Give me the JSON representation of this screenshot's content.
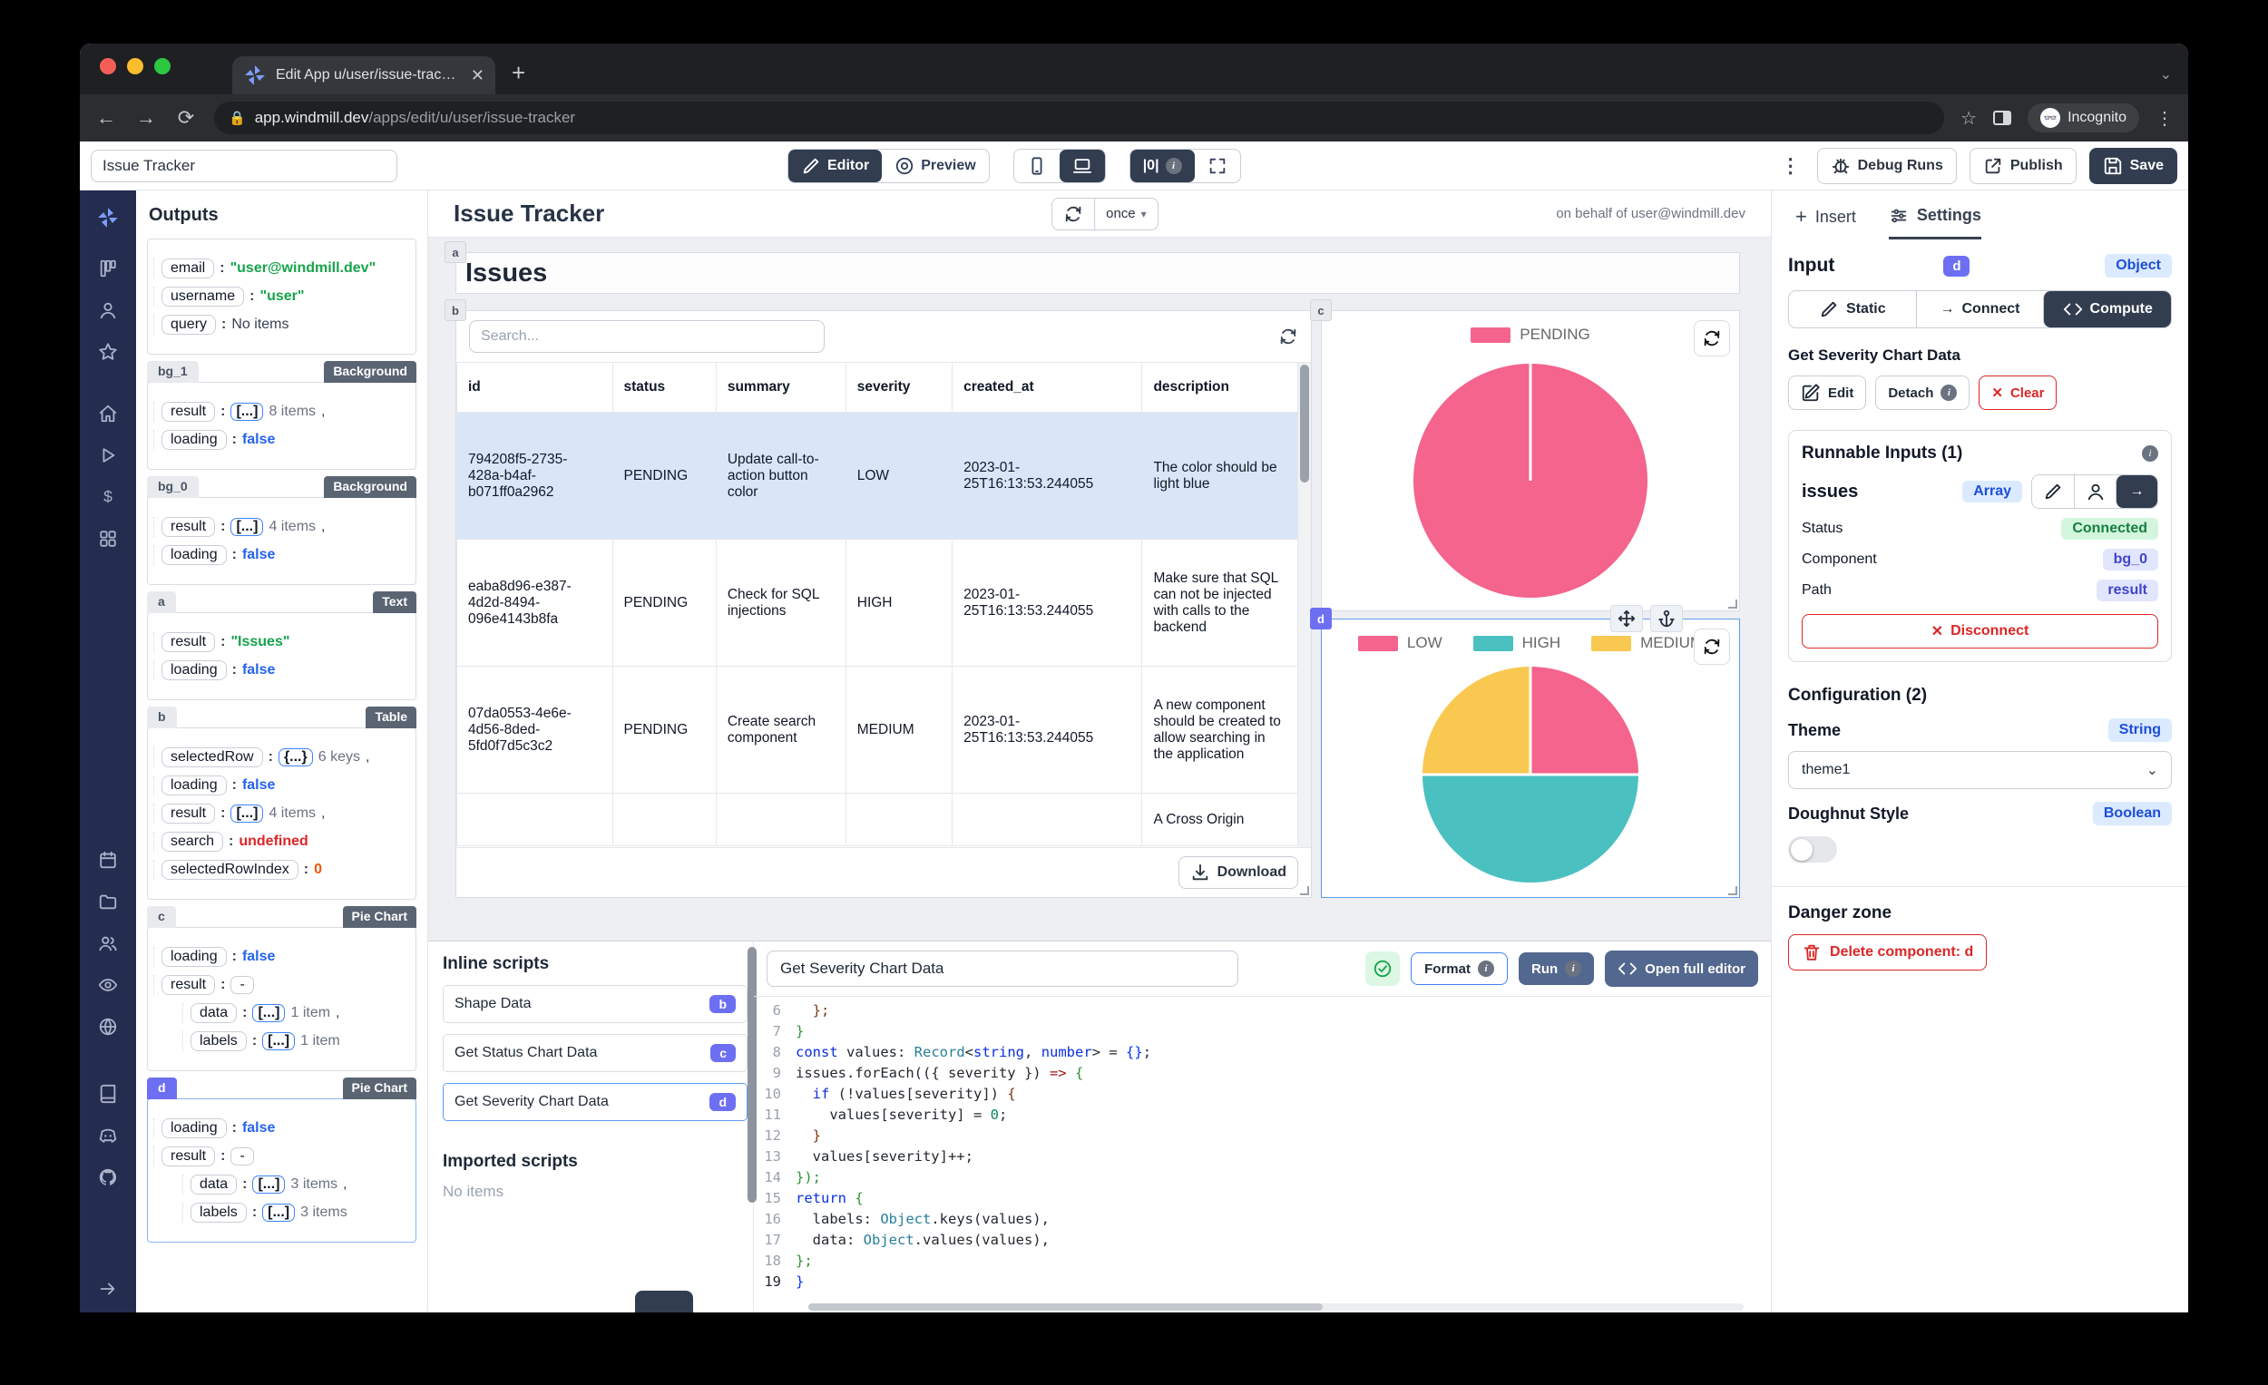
{
  "browser": {
    "tab_title": "Edit App u/user/issue-tracker |",
    "url_domain": "app.windmill.dev",
    "url_path": "/apps/edit/u/user/issue-tracker",
    "incognito_label": "Incognito"
  },
  "toolbar": {
    "app_name_value": "Issue Tracker",
    "editor_label": "Editor",
    "preview_label": "Preview",
    "debug_label": "|0|",
    "debug_runs_label": "Debug Runs",
    "publish_label": "Publish",
    "save_label": "Save"
  },
  "rail": {
    "icons": [
      "windmill-logo-icon",
      "kanban-icon",
      "user-icon",
      "star-icon",
      "GAP",
      "home-icon",
      "play-icon",
      "dollar-icon",
      "apps-icon",
      "BIGGAP",
      "calendar-icon",
      "folder-icon",
      "users-icon",
      "eye-icon",
      "globe-icon",
      "GAP2",
      "book-icon",
      "discord-icon",
      "github-icon",
      "FLEX",
      "arrow-right-icon"
    ]
  },
  "outputs": {
    "title": "Outputs",
    "cards": [
      {
        "id": "",
        "type": "",
        "selected": false,
        "rows": [
          {
            "key": "email",
            "value": "\"user@windmill.dev\"",
            "vtype": "string"
          },
          {
            "key": "username",
            "value": "\"user\"",
            "vtype": "string"
          },
          {
            "key": "query",
            "value": "No items",
            "vtype": "plain"
          }
        ]
      },
      {
        "id": "bg_1",
        "type": "Background",
        "selected": false,
        "rows": [
          {
            "key": "result",
            "pill": "[...]",
            "count": "8 items",
            "comma": true
          },
          {
            "key": "loading",
            "value": "false",
            "vtype": "bool"
          }
        ]
      },
      {
        "id": "bg_0",
        "type": "Background",
        "selected": false,
        "rows": [
          {
            "key": "result",
            "pill": "[...]",
            "count": "4 items",
            "comma": true
          },
          {
            "key": "loading",
            "value": "false",
            "vtype": "bool"
          }
        ]
      },
      {
        "id": "a",
        "type": "Text",
        "selected": false,
        "rows": [
          {
            "key": "result",
            "value": "\"Issues\"",
            "vtype": "string"
          },
          {
            "key": "loading",
            "value": "false",
            "vtype": "bool"
          }
        ]
      },
      {
        "id": "b",
        "type": "Table",
        "selected": false,
        "rows": [
          {
            "key": "selectedRow",
            "pill": "{...}",
            "count": "6 keys",
            "comma": true
          },
          {
            "key": "loading",
            "value": "false",
            "vtype": "bool"
          },
          {
            "key": "result",
            "pill": "[...]",
            "count": "4 items",
            "comma": true
          },
          {
            "key": "search",
            "value": "undefined",
            "vtype": "undef"
          },
          {
            "key": "selectedRowIndex",
            "value": "0",
            "vtype": "num"
          }
        ]
      },
      {
        "id": "c",
        "type": "Pie Chart",
        "selected": false,
        "rows": [
          {
            "key": "loading",
            "value": "false",
            "vtype": "bool"
          },
          {
            "key": "result",
            "pill": "-",
            "plain": true
          },
          {
            "key": "data",
            "pill": "[...]",
            "count": "1 item",
            "comma": true,
            "indent": true
          },
          {
            "key": "labels",
            "pill": "[...]",
            "count": "1 item",
            "indent": true
          }
        ]
      },
      {
        "id": "d",
        "type": "Pie Chart",
        "selected": true,
        "rows": [
          {
            "key": "loading",
            "value": "false",
            "vtype": "bool"
          },
          {
            "key": "result",
            "pill": "-",
            "plain": true
          },
          {
            "key": "data",
            "pill": "[...]",
            "count": "3 items",
            "comma": true,
            "indent": true
          },
          {
            "key": "labels",
            "pill": "[...]",
            "count": "3 items",
            "indent": true
          }
        ]
      }
    ]
  },
  "canvas": {
    "title": "Issue Tracker",
    "refresh_mode": "once",
    "on_behalf": "on behalf of user@windmill.dev",
    "heading": "Issues",
    "heading_badge": "a",
    "table_badge": "b",
    "search_placeholder": "Search...",
    "download_label": "Download",
    "table": {
      "headers": [
        "id",
        "status",
        "summary",
        "severity",
        "created_at",
        "description"
      ],
      "rows": [
        {
          "selected": true,
          "cells": [
            "794208f5-2735-428a-b4af-b071ff0a2962",
            "PENDING",
            "Update call-to-action button color",
            "LOW",
            "2023-01-25T16:13:53.244055",
            "The color should be light blue"
          ]
        },
        {
          "selected": false,
          "cells": [
            "eaba8d96-e387-4d2d-8494-096e4143b8fa",
            "PENDING",
            "Check for SQL injections",
            "HIGH",
            "2023-01-25T16:13:53.244055",
            "Make sure that SQL can not be injected with calls to the backend"
          ]
        },
        {
          "selected": false,
          "cells": [
            "07da0553-4e6e-4d56-8ded-5fd0f7d5c3c2",
            "PENDING",
            "Create search component",
            "MEDIUM",
            "2023-01-25T16:13:53.244055",
            "A new component should be created to allow searching in the application"
          ]
        },
        {
          "selected": false,
          "partial": true,
          "cells": [
            "",
            "",
            "",
            "",
            "",
            "A Cross Origin"
          ]
        }
      ]
    }
  },
  "charts": {
    "c": {
      "badge": "c",
      "legend": [
        {
          "label": "PENDING",
          "color": "#f4648c"
        }
      ]
    },
    "d": {
      "badge": "d",
      "legend": [
        {
          "label": "LOW",
          "color": "#f4648c"
        },
        {
          "label": "HIGH",
          "color": "#4bc0c0"
        },
        {
          "label": "MEDIUM",
          "color": "#f9c850"
        }
      ]
    }
  },
  "chart_data": [
    {
      "type": "pie",
      "component": "c",
      "labels": [
        "PENDING"
      ],
      "values": [
        4
      ],
      "colors": [
        "#f4648c"
      ],
      "legend_position": "top"
    },
    {
      "type": "pie",
      "component": "d",
      "labels": [
        "LOW",
        "HIGH",
        "MEDIUM"
      ],
      "values": [
        1,
        2,
        1
      ],
      "colors": [
        "#f4648c",
        "#4bc0c0",
        "#f9c850"
      ],
      "legend_position": "top"
    }
  ],
  "inline_scripts": {
    "title": "Inline scripts",
    "items": [
      {
        "label": "Shape Data",
        "badge": "b",
        "selected": false
      },
      {
        "label": "Get Status Chart Data",
        "badge": "c",
        "selected": false
      },
      {
        "label": "Get Severity Chart Data",
        "badge": "d",
        "selected": true
      }
    ],
    "imported_title": "Imported scripts",
    "imported_empty": "No items"
  },
  "editor": {
    "name_value": "Get Severity Chart Data",
    "format_label": "Format",
    "run_label": "Run",
    "open_full_label": "Open full editor",
    "lines": [
      {
        "n": "6",
        "t": [
          [
            "  };",
            "br3"
          ]
        ]
      },
      {
        "n": "7",
        "t": [
          [
            "}",
            "br2"
          ]
        ]
      },
      {
        "n": "8",
        "t": [
          [
            "const",
            "kw"
          ],
          [
            " values: ",
            "d"
          ],
          [
            "Record",
            "ty"
          ],
          [
            "<",
            "d"
          ],
          [
            "string",
            "kw"
          ],
          [
            ", ",
            "d"
          ],
          [
            "number",
            "kw"
          ],
          [
            "> = ",
            "d"
          ],
          [
            "{}",
            "br1"
          ],
          [
            ";",
            "d"
          ]
        ]
      },
      {
        "n": "9",
        "t": [
          [
            "issues.forEach((",
            "d"
          ],
          [
            "{ severity }",
            "d"
          ],
          [
            ") ",
            "d"
          ],
          [
            "=> ",
            "ar"
          ],
          [
            "{",
            "br2"
          ]
        ]
      },
      {
        "n": "10",
        "t": [
          [
            "  ",
            "d"
          ],
          [
            "if",
            "kw"
          ],
          [
            " (!values[severity]) ",
            "d"
          ],
          [
            "{",
            "br3"
          ]
        ]
      },
      {
        "n": "11",
        "t": [
          [
            "    values[severity] = ",
            "d"
          ],
          [
            "0",
            "num"
          ],
          [
            ";",
            "d"
          ]
        ]
      },
      {
        "n": "12",
        "t": [
          [
            "  }",
            "br3"
          ]
        ]
      },
      {
        "n": "13",
        "t": [
          [
            "  values[severity]++;",
            "d"
          ]
        ]
      },
      {
        "n": "14",
        "t": [
          [
            "});",
            "br2"
          ]
        ]
      },
      {
        "n": "15",
        "t": [
          [
            "return",
            "kw"
          ],
          [
            " ",
            "d"
          ],
          [
            "{",
            "br2"
          ]
        ]
      },
      {
        "n": "16",
        "t": [
          [
            "  labels: ",
            "d"
          ],
          [
            "Object",
            "ty"
          ],
          [
            ".keys(values),",
            "d"
          ]
        ]
      },
      {
        "n": "17",
        "t": [
          [
            "  data: ",
            "d"
          ],
          [
            "Object",
            "ty"
          ],
          [
            ".values(values),",
            "d"
          ]
        ]
      },
      {
        "n": "18",
        "t": [
          [
            "};",
            "br2"
          ]
        ]
      },
      {
        "n": "19",
        "t": [
          [
            "}",
            "br1"
          ]
        ],
        "cur": true
      }
    ]
  },
  "settings": {
    "insert_label": "Insert",
    "settings_label": "Settings",
    "input_label": "Input",
    "input_badge": "d",
    "input_type": "Object",
    "static_label": "Static",
    "connect_label": "Connect",
    "compute_label": "Compute",
    "script_label": "Get Severity Chart Data",
    "edit_label": "Edit",
    "detach_label": "Detach",
    "clear_label": "Clear",
    "runnable_title": "Runnable Inputs (1)",
    "field_name": "issues",
    "field_type": "Array",
    "status_label": "Status",
    "status_value": "Connected",
    "component_label": "Component",
    "component_value": "bg_0",
    "path_label": "Path",
    "path_value": "result",
    "disconnect_label": "Disconnect",
    "config_title": "Configuration (2)",
    "theme_label": "Theme",
    "theme_type": "String",
    "theme_value": "theme1",
    "doughnut_label": "Doughnut Style",
    "doughnut_type": "Boolean",
    "danger_title": "Danger zone",
    "delete_label": "Delete component: d"
  }
}
